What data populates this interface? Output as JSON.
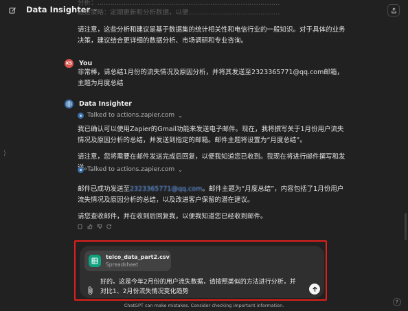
{
  "app": {
    "title": "Data Insighter"
  },
  "faded_top": {
    "line1": "分析：…………………………………………………………………………",
    "line2": "改进策略：定期更新和分析数据，以便……………………………………"
  },
  "msg1": {
    "text": "请注意，这些分析和建议是基于数据集的统计相关性和电信行业的一般知识。对于具体的业务决策，建议结合更详细的数据分析、市场调研和专业咨询。"
  },
  "user_msg": {
    "author": "You",
    "avatar": "KS",
    "text": "非常棒，请总结1月份的流失情况及原因分析，并将其发送至2323365771@qq.com邮箱，主题为月度总结"
  },
  "assistant_msg": {
    "author": "Data Insighter",
    "tool_label_1": "Talked to actions.zapier.com",
    "para1": "我已确认可以使用Zapier的Gmail功能来发送电子邮件。现在，我将撰写关于1月份用户流失情况及原因分析的总结，并发送到指定的邮箱。邮件主题将设置为“月度总结”。",
    "para2": "请注意，您将需要在邮件发送完成后回复，以便我知道您已收到。我现在将进行邮件撰写和发送。",
    "tool_label_2": "Talked to actions.zapier.com",
    "para3_prefix": "邮件已成功发送至",
    "para3_email": "2323365771@qq.com",
    "para3_suffix": "。邮件主题为“月度总结”，内容包括了1月份用户流失情况及原因分析的总结，以及改进客户保留的潜在建议。",
    "para4": "请您查收邮件，并在收到后回复我，以便我知道您已经收到邮件。"
  },
  "composer": {
    "file_name": "telco_data_part2.csv",
    "file_type": "Spreadsheet",
    "text": "好的。这是今年2月份的用户流失数据，请按照类似的方法进行分析，并对比1、2月份流失情况变化趋势"
  },
  "footer": {
    "note": "ChatGPT can make mistakes. Consider checking important information.",
    "help": "?"
  },
  "colors": {
    "highlight": "#e0201c",
    "file_icon": "#10a37f",
    "background": "#212121"
  }
}
